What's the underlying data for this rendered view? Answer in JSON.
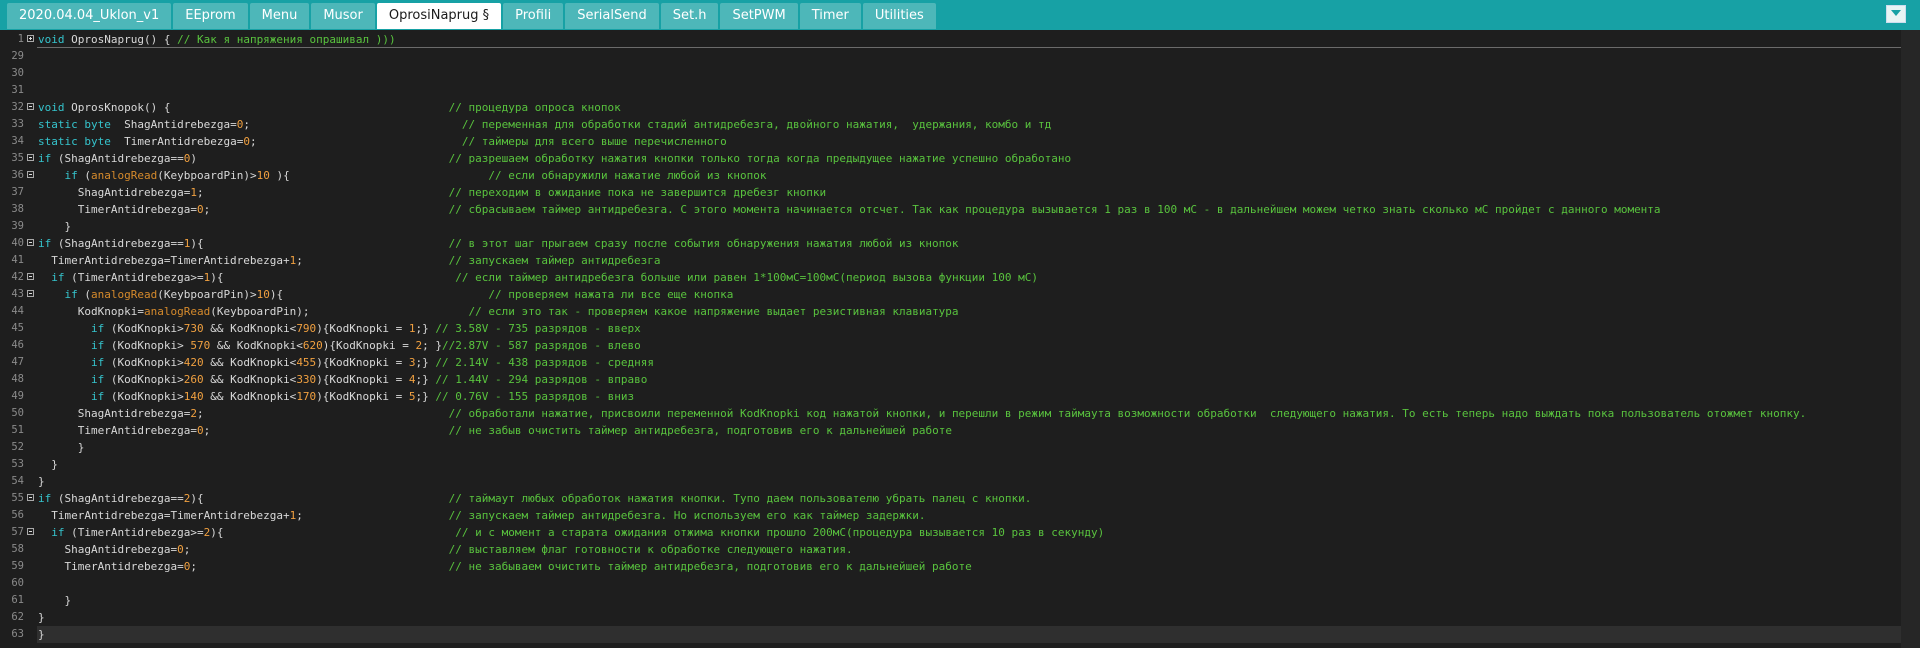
{
  "tabs": [
    {
      "label": "2020.04.04_Uklon_v1",
      "active": false
    },
    {
      "label": "EEprom",
      "active": false
    },
    {
      "label": "Menu",
      "active": false
    },
    {
      "label": "Musor",
      "active": false
    },
    {
      "label": "OprosiNaprug §",
      "active": true
    },
    {
      "label": "Profili",
      "active": false
    },
    {
      "label": "SerialSend",
      "active": false
    },
    {
      "label": "Set.h",
      "active": false
    },
    {
      "label": "SetPWM",
      "active": false
    },
    {
      "label": "Timer",
      "active": false
    },
    {
      "label": "Utilities",
      "active": false
    }
  ],
  "current_line": "63",
  "colors": {
    "tabbar": "#17a1a5",
    "tab": "#4db7b9",
    "editor_bg": "#1e1e1e",
    "keyword": "#35c4cd",
    "function": "#d58a2c",
    "comment": "#59c33e",
    "number": "#f0a040"
  },
  "lines": [
    {
      "n": "1",
      "fold": "plus",
      "seg": [
        [
          "kw",
          "void"
        ],
        [
          "",
          " OprosNaprug() { "
        ],
        [
          "cm",
          "// Как я напряжения опрашивал )))"
        ]
      ]
    },
    {
      "n": "29",
      "seg": []
    },
    {
      "n": "30",
      "seg": []
    },
    {
      "n": "31",
      "seg": []
    },
    {
      "n": "32",
      "fold": "minus",
      "seg": [
        [
          "kw",
          "void"
        ],
        [
          "",
          " OprosKnopok() {                                          "
        ],
        [
          "cm",
          "// процедура опроса кнопок"
        ]
      ]
    },
    {
      "n": "33",
      "seg": [
        [
          "kw",
          "static byte"
        ],
        [
          "",
          "  ShagAntidrebezga="
        ],
        [
          "num",
          "0"
        ],
        [
          "",
          ";                                "
        ],
        [
          "cm",
          "// переменная для обработки стадий антидребезга, двойного нажатия,  удержания, комбо и тд"
        ]
      ]
    },
    {
      "n": "34",
      "seg": [
        [
          "kw",
          "static byte"
        ],
        [
          "",
          "  TimerAntidrebezga="
        ],
        [
          "num",
          "0"
        ],
        [
          "",
          ";                               "
        ],
        [
          "cm",
          "// таймеры для всего выше перечисленного"
        ]
      ]
    },
    {
      "n": "35",
      "fold": "minus",
      "seg": [
        [
          "kw",
          "if"
        ],
        [
          "",
          " (ShagAntidrebezga=="
        ],
        [
          "num",
          "0"
        ],
        [
          "",
          ")                                      "
        ],
        [
          "cm",
          "// разрешаем обработку нажатия кнопки только тогда когда предыдущее нажатие успешно обработано"
        ]
      ]
    },
    {
      "n": "36",
      "fold": "minus",
      "seg": [
        [
          "",
          "    "
        ],
        [
          "kw",
          "if"
        ],
        [
          "",
          " ("
        ],
        [
          "fn",
          "analogRead"
        ],
        [
          "",
          "(KeybpoardPin)>"
        ],
        [
          "num",
          "10"
        ],
        [
          "",
          " ){                              "
        ],
        [
          "cm",
          "// если обнаружили нажатие любой из кнопок"
        ]
      ]
    },
    {
      "n": "37",
      "seg": [
        [
          "",
          "      ShagAntidrebezga="
        ],
        [
          "num",
          "1"
        ],
        [
          "",
          ";                                     "
        ],
        [
          "cm",
          "// переходим в ожидание пока не завершится дребезг кнопки"
        ]
      ]
    },
    {
      "n": "38",
      "seg": [
        [
          "",
          "      TimerAntidrebezga="
        ],
        [
          "num",
          "0"
        ],
        [
          "",
          ";                                    "
        ],
        [
          "cm",
          "// сбрасываем таймер антидребезга. С этого момента начинается отсчет. Так как процедура вызывается 1 раз в 100 мС - в дальнейшем можем четко знать сколько мС пройдет с данного момента"
        ]
      ]
    },
    {
      "n": "39",
      "seg": [
        [
          "",
          "    }"
        ]
      ]
    },
    {
      "n": "40",
      "fold": "minus",
      "seg": [
        [
          "kw",
          "if"
        ],
        [
          "",
          " (ShagAntidrebezga=="
        ],
        [
          "num",
          "1"
        ],
        [
          "",
          "){                                     "
        ],
        [
          "cm",
          "// в этот шаг прыгаем сразу после события обнаружения нажатия любой из кнопок"
        ]
      ]
    },
    {
      "n": "41",
      "seg": [
        [
          "",
          "  TimerAntidrebezga=TimerAntidrebezga+"
        ],
        [
          "num",
          "1"
        ],
        [
          "",
          ";                      "
        ],
        [
          "cm",
          "// запускаем таймер антидребезга"
        ]
      ]
    },
    {
      "n": "42",
      "fold": "minus",
      "seg": [
        [
          "",
          "  "
        ],
        [
          "kw",
          "if"
        ],
        [
          "",
          " (TimerAntidrebezga>="
        ],
        [
          "num",
          "1"
        ],
        [
          "",
          "){                                   "
        ],
        [
          "cm",
          "// если таймер антидребезга больше или равен 1*100мС=100мС(период вызова функции 100 мС)"
        ]
      ]
    },
    {
      "n": "43",
      "fold": "minus",
      "seg": [
        [
          "",
          "    "
        ],
        [
          "kw",
          "if"
        ],
        [
          "",
          " ("
        ],
        [
          "fn",
          "analogRead"
        ],
        [
          "",
          "(KeybpoardPin)>"
        ],
        [
          "num",
          "10"
        ],
        [
          "",
          "){                               "
        ],
        [
          "cm",
          "// проверяем нажата ли все еще кнопка"
        ]
      ]
    },
    {
      "n": "44",
      "seg": [
        [
          "",
          "      KodKnopki="
        ],
        [
          "fn",
          "analogRead"
        ],
        [
          "",
          "(KeybpoardPin);                        "
        ],
        [
          "cm",
          "// если это так - проверяем какое напряжение выдает резистивная клавиатура"
        ]
      ]
    },
    {
      "n": "45",
      "seg": [
        [
          "",
          "        "
        ],
        [
          "kw",
          "if"
        ],
        [
          "",
          " (KodKnopki>"
        ],
        [
          "num",
          "730"
        ],
        [
          "",
          " && KodKnopki<"
        ],
        [
          "num",
          "790"
        ],
        [
          "",
          "){KodKnopki = "
        ],
        [
          "num",
          "1"
        ],
        [
          "",
          ";} "
        ],
        [
          "cm",
          "// 3.58V - 735 разрядов - вверх"
        ]
      ]
    },
    {
      "n": "46",
      "seg": [
        [
          "",
          "        "
        ],
        [
          "kw",
          "if"
        ],
        [
          "",
          " (KodKnopki> "
        ],
        [
          "num",
          "570"
        ],
        [
          "",
          " && KodKnopki<"
        ],
        [
          "num",
          "620"
        ],
        [
          "",
          "){KodKnopki = "
        ],
        [
          "num",
          "2"
        ],
        [
          "",
          "; }"
        ],
        [
          "cm",
          "//2.87V - 587 разрядов - влево"
        ]
      ]
    },
    {
      "n": "47",
      "seg": [
        [
          "",
          "        "
        ],
        [
          "kw",
          "if"
        ],
        [
          "",
          " (KodKnopki>"
        ],
        [
          "num",
          "420"
        ],
        [
          "",
          " && KodKnopki<"
        ],
        [
          "num",
          "455"
        ],
        [
          "",
          "){KodKnopki = "
        ],
        [
          "num",
          "3"
        ],
        [
          "",
          ";} "
        ],
        [
          "cm",
          "// 2.14V - 438 разрядов - средняя"
        ]
      ]
    },
    {
      "n": "48",
      "seg": [
        [
          "",
          "        "
        ],
        [
          "kw",
          "if"
        ],
        [
          "",
          " (KodKnopki>"
        ],
        [
          "num",
          "260"
        ],
        [
          "",
          " && KodKnopki<"
        ],
        [
          "num",
          "330"
        ],
        [
          "",
          "){KodKnopki = "
        ],
        [
          "num",
          "4"
        ],
        [
          "",
          ";} "
        ],
        [
          "cm",
          "// 1.44V - 294 разрядов - вправо"
        ]
      ]
    },
    {
      "n": "49",
      "seg": [
        [
          "",
          "        "
        ],
        [
          "kw",
          "if"
        ],
        [
          "",
          " (KodKnopki>"
        ],
        [
          "num",
          "140"
        ],
        [
          "",
          " && KodKnopki<"
        ],
        [
          "num",
          "170"
        ],
        [
          "",
          "){KodKnopki = "
        ],
        [
          "num",
          "5"
        ],
        [
          "",
          ";} "
        ],
        [
          "cm",
          "// 0.76V - 155 разрядов - вниз"
        ]
      ]
    },
    {
      "n": "50",
      "seg": [
        [
          "",
          "      ShagAntidrebezga="
        ],
        [
          "num",
          "2"
        ],
        [
          "",
          ";                                     "
        ],
        [
          "cm",
          "// обработали нажатие, присвоили переменной KodKnopki код нажатой кнопки, и перешли в режим таймаута возможности обработки  следующего нажатия. То есть теперь надо выждать пока пользователь отожмет кнопку."
        ]
      ]
    },
    {
      "n": "51",
      "seg": [
        [
          "",
          "      TimerAntidrebezga="
        ],
        [
          "num",
          "0"
        ],
        [
          "",
          ";                                    "
        ],
        [
          "cm",
          "// не забыв очистить таймер антидребезга, подготовив его к дальнейшей работе"
        ]
      ]
    },
    {
      "n": "52",
      "seg": [
        [
          "",
          "      }"
        ]
      ]
    },
    {
      "n": "53",
      "seg": [
        [
          "",
          "  }"
        ]
      ]
    },
    {
      "n": "54",
      "seg": [
        [
          "",
          "}"
        ]
      ]
    },
    {
      "n": "55",
      "fold": "minus",
      "seg": [
        [
          "kw",
          "if"
        ],
        [
          "",
          " (ShagAntidrebezga=="
        ],
        [
          "num",
          "2"
        ],
        [
          "",
          "){                                     "
        ],
        [
          "cm",
          "// таймаут любых обработок нажатия кнопки. Тупо даем пользователю убрать палец с кнопки."
        ]
      ]
    },
    {
      "n": "56",
      "seg": [
        [
          "",
          "  TimerAntidrebezga=TimerAntidrebezga+"
        ],
        [
          "num",
          "1"
        ],
        [
          "",
          ";                      "
        ],
        [
          "cm",
          "// запускаем таймер антидребезга. Но используем его как таймер задержки."
        ]
      ]
    },
    {
      "n": "57",
      "fold": "minus",
      "seg": [
        [
          "",
          "  "
        ],
        [
          "kw",
          "if"
        ],
        [
          "",
          " (TimerAntidrebezga>="
        ],
        [
          "num",
          "2"
        ],
        [
          "",
          "){                                   "
        ],
        [
          "cm",
          "// и с момент а старата ожидания отжима кнопки прошло 200мС(процедура вызывается 10 раз в секунду)"
        ]
      ]
    },
    {
      "n": "58",
      "seg": [
        [
          "",
          "    ShagAntidrebezga="
        ],
        [
          "num",
          "0"
        ],
        [
          "",
          ";                                       "
        ],
        [
          "cm",
          "// выставляем флаг готовности к обработке следующего нажатия."
        ]
      ]
    },
    {
      "n": "59",
      "seg": [
        [
          "",
          "    TimerAntidrebezga="
        ],
        [
          "num",
          "0"
        ],
        [
          "",
          ";                                      "
        ],
        [
          "cm",
          "// не забываем очистить таймер антидребезга, подготовив его к дальнейшей работе"
        ]
      ]
    },
    {
      "n": "60",
      "seg": []
    },
    {
      "n": "61",
      "seg": [
        [
          "",
          "    }"
        ]
      ]
    },
    {
      "n": "62",
      "seg": [
        [
          "",
          "}"
        ]
      ]
    },
    {
      "n": "63",
      "seg": [
        [
          "",
          "}"
        ]
      ]
    }
  ]
}
